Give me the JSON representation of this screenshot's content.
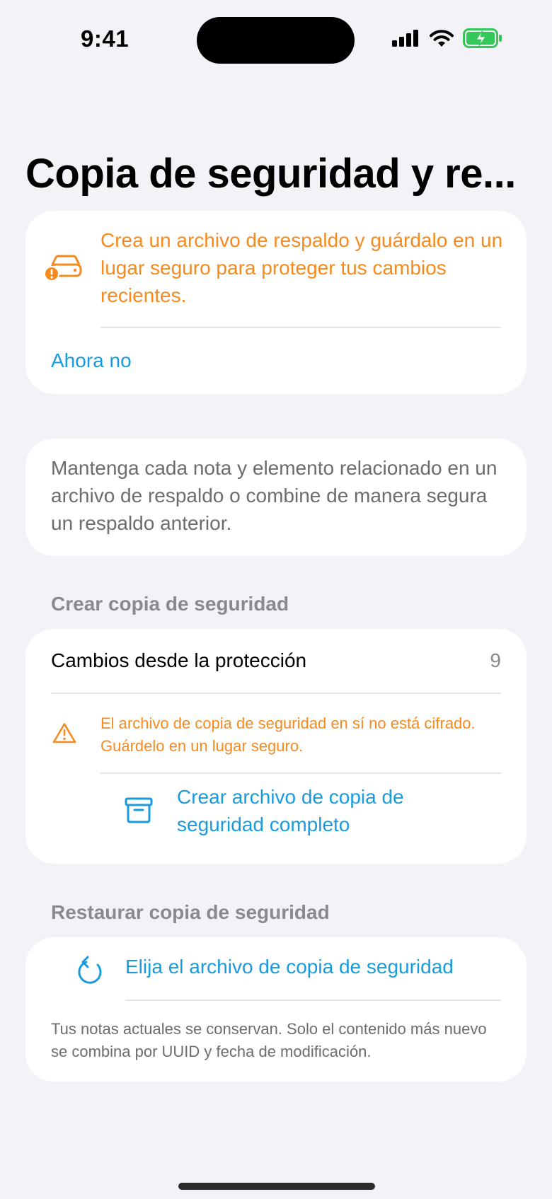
{
  "status_bar": {
    "time": "9:41"
  },
  "page": {
    "title": "Copia de seguridad y re..."
  },
  "alert": {
    "message": "Crea un archivo de respaldo y guárdalo en un lugar seguro para proteger tus cambios recientes.",
    "dismiss_label": "Ahora no",
    "icon": "drive-warning-icon",
    "color": "#F68A1E"
  },
  "info": {
    "text": "Mantenga cada nota y elemento relacionado en un archivo de respaldo o combine de manera segura un respaldo anterior."
  },
  "create_section": {
    "header": "Crear copia de seguridad",
    "changes_label": "Cambios desde la protección",
    "changes_count": "9",
    "warning": "El archivo de copia de seguridad en sí no está cifrado. Guárdelo en un lugar seguro.",
    "create_button_label": "Crear archivo de copia de seguridad completo"
  },
  "restore_section": {
    "header": "Restaurar copia de seguridad",
    "choose_button_label": "Elija el archivo de copia de seguridad",
    "note": "Tus notas actuales se conservan. Solo el contenido más nuevo se combina por UUID y fecha de modificación."
  },
  "colors": {
    "accent": "#1A9BDD",
    "warning": "#F68A1E",
    "background": "#F2F2F7",
    "battery": "#34C759"
  }
}
